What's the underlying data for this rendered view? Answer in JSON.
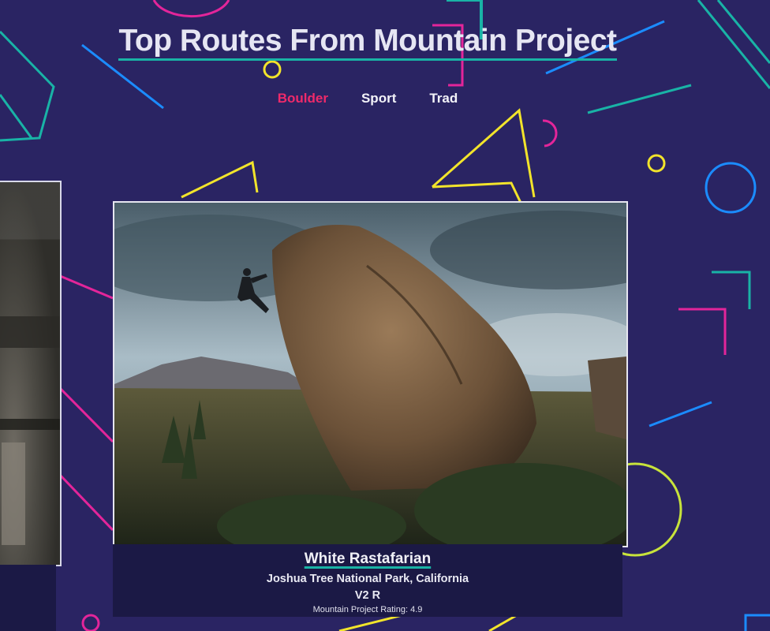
{
  "header": {
    "title": "Top Routes From Mountain Project"
  },
  "tabs": [
    {
      "label": "Boulder",
      "active": true
    },
    {
      "label": "Sport",
      "active": false
    },
    {
      "label": "Trad",
      "active": false
    }
  ],
  "route": {
    "name": "White Rastafarian",
    "location": "Joshua Tree National Park, California",
    "grade": "V2 R",
    "rating": "Mountain Project Rating: 4.9"
  },
  "colors": {
    "background": "#2a2463",
    "accent_pink": "#ef2a6a",
    "accent_teal": "#19b3a6",
    "accent_yellow": "#f2e42b",
    "accent_blue": "#1b8cff",
    "caption_bg": "#1b1945"
  }
}
